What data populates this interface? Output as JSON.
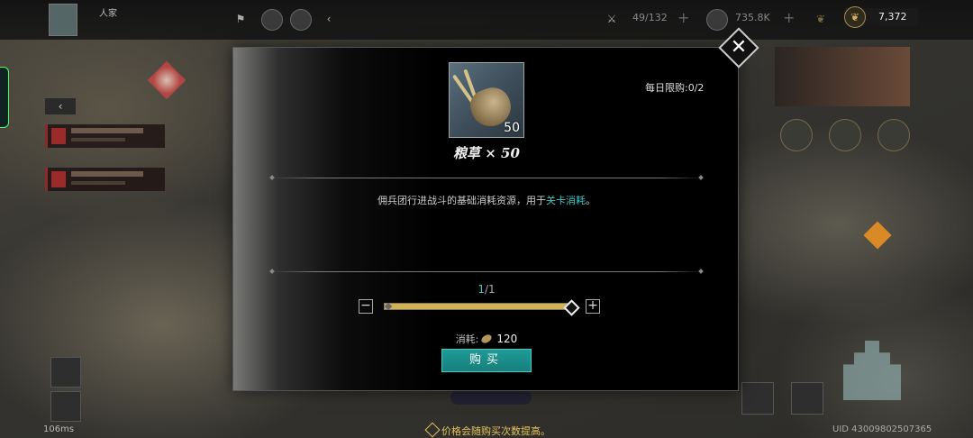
{
  "hud": {
    "player_name": "人家",
    "troops": "49/132",
    "silver": "735.8K",
    "gold": "7,372",
    "ping": "106ms",
    "uid": "UID 43009802507365"
  },
  "price_note": "价格会随购买次数提高。",
  "modal": {
    "daily_limit": "每日限购:0/2",
    "item_count": "50",
    "item_name": "粮草 × 50",
    "description_prefix": "佣兵团行进战斗的基础消耗资源，用于",
    "description_highlight": "关卡消耗",
    "description_suffix": "。",
    "quantity_current": "1",
    "quantity_max": "/1",
    "quantity_fraction": 1.0,
    "cost_label": "消耗:",
    "cost_value": "120",
    "buy_label": "购买",
    "minus_symbol": "−",
    "plus_symbol": "+",
    "close_symbol": "✕"
  },
  "icons": {
    "close": "close-icon",
    "item": "grain-sack-icon",
    "cost_currency": "grain-icon"
  },
  "colors": {
    "accent": "#3ec7c3",
    "slider_fill": "#d4b24c",
    "button": "#1f9a96",
    "warning": "#e4c25c"
  }
}
